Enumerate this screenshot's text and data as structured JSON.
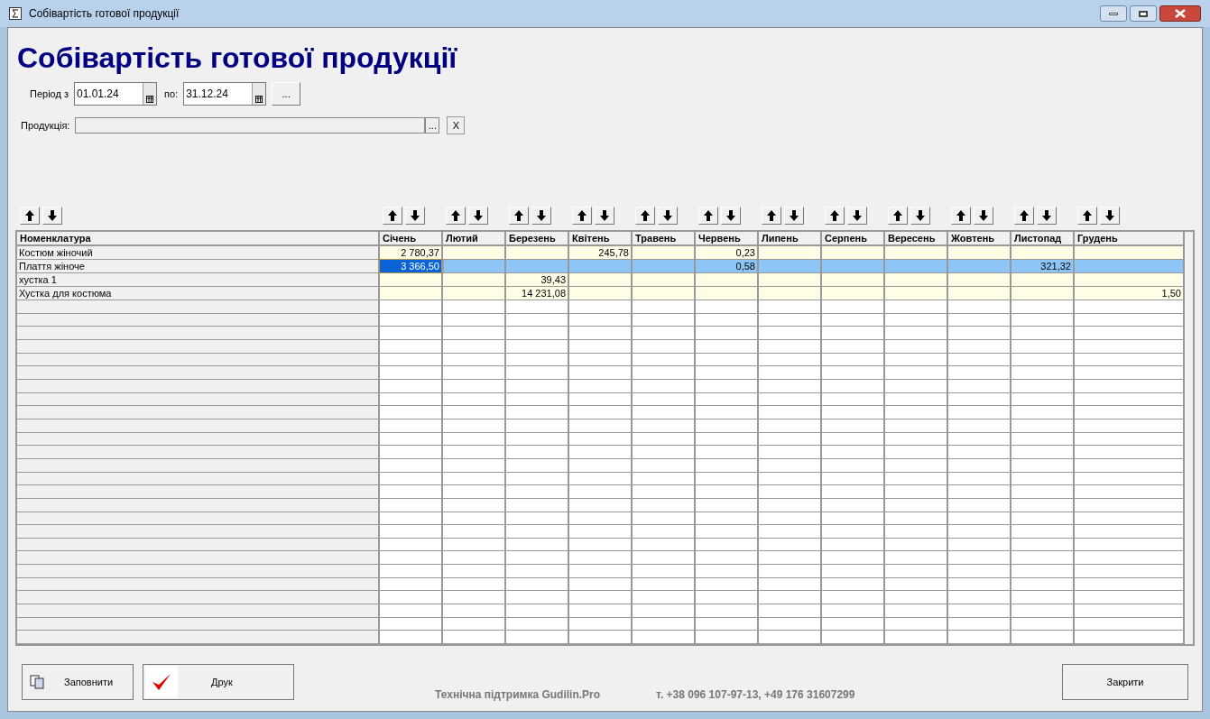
{
  "window": {
    "title": "Собівартість готової продукції"
  },
  "heading": "Собівартість готової продукції",
  "period": {
    "from_label": "Період з",
    "from_value": "01.01.24",
    "to_label": "по:",
    "to_value": "31.12.24",
    "more_button": "..."
  },
  "product": {
    "label": "Продукція:",
    "browse_button": "...",
    "clear_button": "X"
  },
  "table": {
    "columns": [
      "Номенклатура",
      "Січень",
      "Лютий",
      "Березень",
      "Квітень",
      "Травень",
      "Червень",
      "Липень",
      "Серпень",
      "Вересень",
      "Жовтень",
      "Листопад",
      "Грудень"
    ],
    "rows": [
      {
        "selected": false,
        "cells": [
          {
            "value": "Костюм жіночий",
            "focused": false
          },
          {
            "value": "2 780,37",
            "focused": false
          },
          {
            "focused": false
          },
          {
            "focused": false
          },
          {
            "value": "245,78",
            "focused": false
          },
          {
            "focused": false
          },
          {
            "value": "0,23",
            "focused": false
          },
          {
            "focused": false
          },
          {
            "focused": false
          },
          {
            "focused": false
          },
          {
            "focused": false
          },
          {
            "focused": false
          },
          {
            "focused": false
          }
        ]
      },
      {
        "selected": true,
        "cells": [
          {
            "value": "Плаття жіноче",
            "focused": false
          },
          {
            "value": "3 366,50",
            "focused": true
          },
          {
            "focused": false
          },
          {
            "focused": false
          },
          {
            "focused": false
          },
          {
            "focused": false
          },
          {
            "value": "0,58",
            "focused": false
          },
          {
            "focused": false
          },
          {
            "focused": false
          },
          {
            "focused": false
          },
          {
            "focused": false
          },
          {
            "value": "321,32",
            "focused": false
          },
          {
            "focused": false
          }
        ]
      },
      {
        "selected": false,
        "cells": [
          {
            "value": "хустка 1",
            "focused": false
          },
          {
            "focused": false
          },
          {
            "focused": false
          },
          {
            "value": "39,43",
            "focused": false
          },
          {
            "focused": false
          },
          {
            "focused": false
          },
          {
            "focused": false
          },
          {
            "focused": false
          },
          {
            "focused": false
          },
          {
            "focused": false
          },
          {
            "focused": false
          },
          {
            "focused": false
          },
          {
            "focused": false
          }
        ]
      },
      {
        "selected": false,
        "cells": [
          {
            "value": "Хустка для костюма",
            "focused": false
          },
          {
            "focused": false
          },
          {
            "focused": false
          },
          {
            "value": "14 231,08",
            "focused": false
          },
          {
            "focused": false
          },
          {
            "focused": false
          },
          {
            "focused": false
          },
          {
            "focused": false
          },
          {
            "focused": false
          },
          {
            "focused": false
          },
          {
            "focused": false
          },
          {
            "focused": false
          },
          {
            "value": "1,50",
            "focused": false
          }
        ]
      }
    ]
  },
  "buttons": {
    "fill": "Заповнити",
    "print": "Друк",
    "close": "Закрити"
  },
  "footer": {
    "support": "Технічна підтримка Gudilin.Pro",
    "phones": "т. +38 096 107-97-13, +49 176 31607299"
  }
}
